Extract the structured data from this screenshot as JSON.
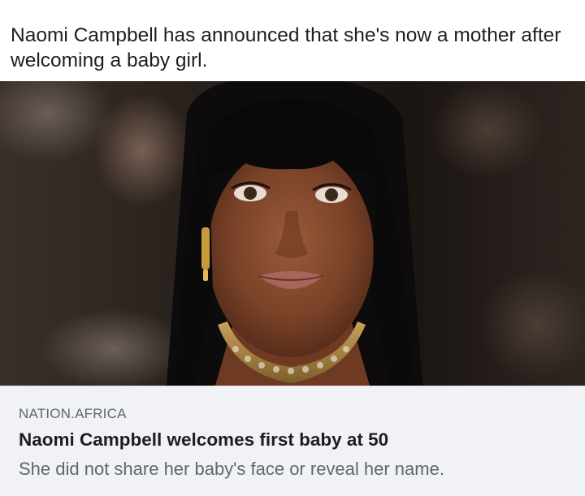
{
  "post": {
    "caption": "Naomi Campbell has announced that she's now a mother after welcoming a baby girl."
  },
  "link_preview": {
    "domain": "NATION.AFRICA",
    "headline": "Naomi Campbell welcomes first baby at 50",
    "subtitle": "She did not share her baby's face or reveal her name."
  },
  "colors": {
    "card_background": "#f0f2f5",
    "text_primary": "#1c1e21",
    "text_secondary": "#606770"
  }
}
